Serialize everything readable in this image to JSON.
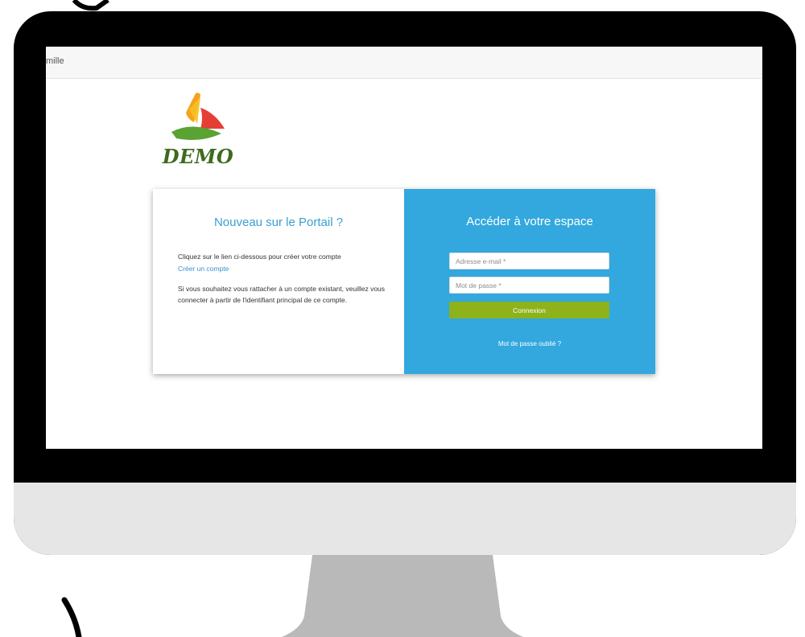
{
  "topbar": {
    "text": "mille"
  },
  "logo": {
    "text": "DEMO"
  },
  "new_user": {
    "title": "Nouveau sur le Portail ?",
    "intro": "Cliquez sur le lien ci-dessous pour créer votre compte",
    "create_link": "Créer un compte",
    "attach_text": "Si vous souhaitez vous rattacher à un compte existant, veuillez vous connecter à partir de l'identifiant principal de ce compte."
  },
  "login": {
    "title": "Accéder à votre espace",
    "email_placeholder": "Adresse e-mail *",
    "email_value": "",
    "password_placeholder": "Mot de passe *",
    "password_value": "",
    "submit_label": "Connexion",
    "forgot_link": "Mot de passe oublié ?"
  },
  "colors": {
    "accent_blue": "#32a8de",
    "title_blue": "#3a9fd3",
    "button_green": "#8db21a",
    "logo_green": "#3e6a1f",
    "bezel": "#000000",
    "chin": "#e6e6e6",
    "stand": "#b9b9b9"
  },
  "icons": {
    "logo_mark": "tricolor-triangle-logo-icon"
  }
}
